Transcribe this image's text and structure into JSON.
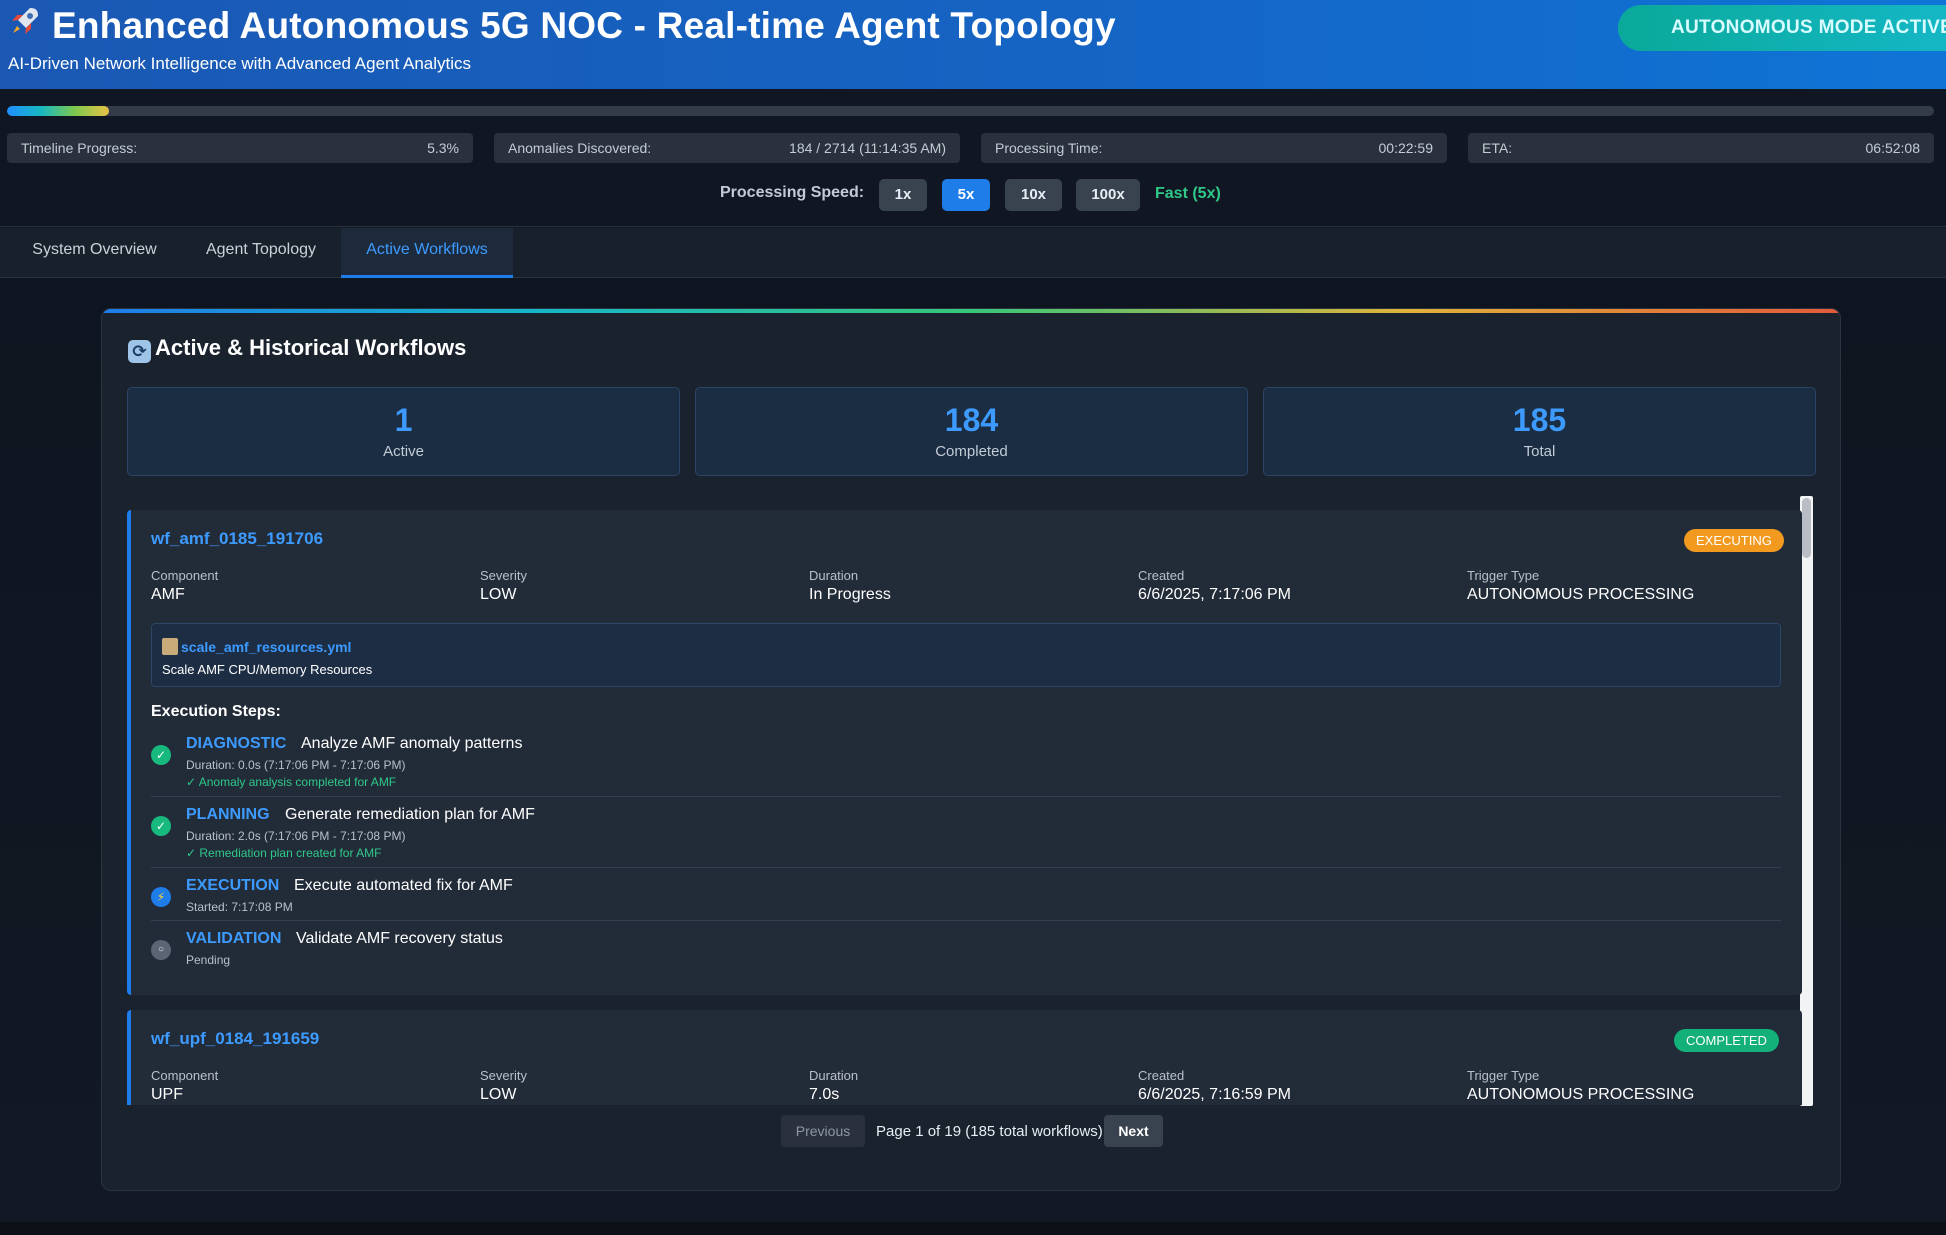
{
  "header": {
    "title": "Enhanced Autonomous 5G NOC - Real-time Agent Topology",
    "subtitle": "AI-Driven Network Intelligence with Advanced Agent Analytics",
    "mode_badge": "AUTONOMOUS MODE ACTIVE",
    "icon": "rocket-icon"
  },
  "progress": {
    "fraction": 0.053,
    "stats": [
      {
        "label": "Timeline Progress:",
        "value": "5.3%"
      },
      {
        "label": "Anomalies Discovered:",
        "value": "184 / 2714 (11:14:35 AM)"
      },
      {
        "label": "Processing Time:",
        "value": "00:22:59"
      },
      {
        "label": "ETA:",
        "value": "06:52:08"
      }
    ]
  },
  "speed": {
    "label": "Processing Speed:",
    "options": [
      "1x",
      "5x",
      "10x",
      "100x"
    ],
    "selected": "5x",
    "status": "Fast (5x)"
  },
  "tabs": [
    "System Overview",
    "Agent Topology",
    "Active Workflows"
  ],
  "active_tab": "Active Workflows",
  "panel": {
    "title": "Active & Historical Workflows",
    "icon": "refresh-icon",
    "summary": [
      {
        "value": "1",
        "label": "Active"
      },
      {
        "value": "184",
        "label": "Completed"
      },
      {
        "value": "185",
        "label": "Total"
      }
    ]
  },
  "workflows": [
    {
      "id": "wf_amf_0185_191706",
      "status": "EXECUTING",
      "meta": [
        {
          "key": "Component",
          "value": "AMF"
        },
        {
          "key": "Severity",
          "value": "LOW"
        },
        {
          "key": "Duration",
          "value": "In Progress"
        },
        {
          "key": "Created",
          "value": "6/6/2025, 7:17:06 PM"
        },
        {
          "key": "Trigger Type",
          "value": "AUTONOMOUS PROCESSING"
        }
      ],
      "playbook": {
        "name": "scale_amf_resources.yml",
        "description": "Scale AMF CPU/Memory Resources",
        "icon": "clipboard-icon"
      },
      "steps_title": "Execution Steps:",
      "steps": [
        {
          "phase": "DIAGNOSTIC",
          "description": "Analyze AMF anomaly patterns",
          "detail": "Duration: 0.0s (7:17:06 PM - 7:17:06 PM)",
          "result": "✓ Anomaly analysis completed for AMF",
          "state": "done"
        },
        {
          "phase": "PLANNING",
          "description": "Generate remediation plan for AMF",
          "detail": "Duration: 2.0s (7:17:06 PM - 7:17:08 PM)",
          "result": "✓ Remediation plan created for AMF",
          "state": "done"
        },
        {
          "phase": "EXECUTION",
          "description": "Execute automated fix for AMF",
          "detail": "Started: 7:17:08 PM",
          "result": "",
          "state": "running"
        },
        {
          "phase": "VALIDATION",
          "description": "Validate AMF recovery status",
          "detail": "Pending",
          "result": "",
          "state": "pending"
        }
      ]
    },
    {
      "id": "wf_upf_0184_191659",
      "status": "COMPLETED",
      "meta": [
        {
          "key": "Component",
          "value": "UPF"
        },
        {
          "key": "Severity",
          "value": "LOW"
        },
        {
          "key": "Duration",
          "value": "7.0s"
        },
        {
          "key": "Created",
          "value": "6/6/2025, 7:16:59 PM"
        },
        {
          "key": "Trigger Type",
          "value": "AUTONOMOUS PROCESSING"
        }
      ]
    }
  ],
  "pagination": {
    "previous": "Previous",
    "info": "Page 1 of 19 (185 total workflows)",
    "next": "Next"
  },
  "colors": {
    "accent": "#1e7de8",
    "executing": "#f29a1f",
    "completed": "#13b07a",
    "success_text": "#2fc98a"
  }
}
